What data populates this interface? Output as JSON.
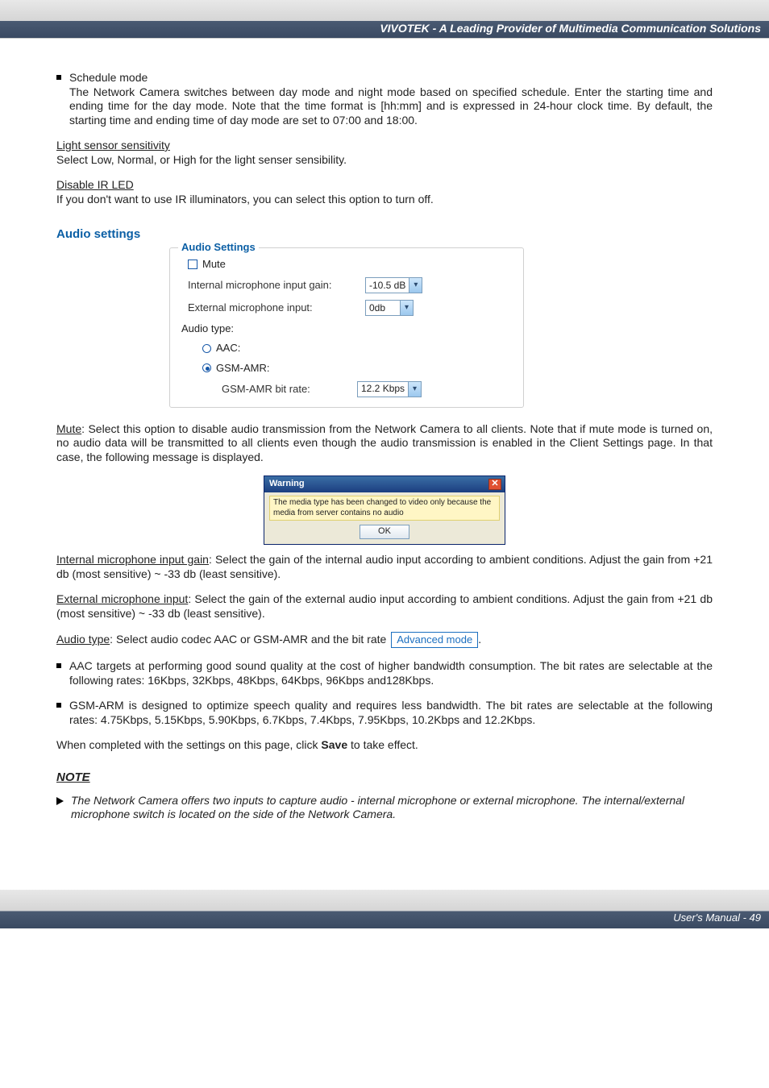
{
  "header": {
    "title": "VIVOTEK - A Leading Provider of Multimedia Communication Solutions"
  },
  "schedule": {
    "label": "Schedule mode",
    "body": "The Network Camera switches between day mode and night mode based on specified schedule. Enter the starting time and ending time for the day mode. Note that the time format is [hh:mm] and is expressed in 24-hour clock time. By default, the starting time and ending time of day mode are set to 07:00 and 18:00."
  },
  "light": {
    "heading": "Light sensor sensitivity",
    "body": "Select Low, Normal, or High for the light senser sensibility."
  },
  "irled": {
    "heading": "Disable IR LED",
    "body": "If you don't want to use IR illuminators, you can select this option to turn off."
  },
  "audio": {
    "title": "Audio settings",
    "panel": {
      "legend": "Audio Settings",
      "mute": "Mute",
      "int_gain_label": "Internal microphone input gain:",
      "int_gain_val": "-10.5 dB",
      "ext_label": "External microphone input:",
      "ext_val": "0db",
      "type_label": "Audio type:",
      "aac": "AAC:",
      "gsm": "GSM-AMR:",
      "gsm_rate_label": "GSM-AMR bit rate:",
      "gsm_rate_val": "12.2 Kbps"
    },
    "mute_head": "Mute",
    "mute_body": ": Select this option to disable audio transmission from the Network Camera to all clients. Note that if mute mode is turned on, no audio data will be transmitted to all clients even though the audio transmission is enabled in the Client Settings page. In that case, the following message is displayed.",
    "dialog": {
      "title": "Warning",
      "msg": "The media type has been changed to video only because the media from server contains no audio",
      "ok": "OK"
    },
    "int_head": "Internal microphone input gain",
    "int_body": ": Select the gain of the internal audio input according to ambient conditions. Adjust the gain from +21 db (most sensitive) ~ -33 db (least sensitive).",
    "ext_head": "External microphone input",
    "ext_body": ": Select the gain of the external audio input according to ambient conditions. Adjust the gain from +21 db (most sensitive) ~ -33 db (least sensitive).",
    "type_head": "Audio type",
    "type_body1": ": Select audio codec AAC or GSM-AMR and the bit rate",
    "type_badge": "Advanced mode",
    "type_body2": ".",
    "aac_bullet": "AAC targets at performing good sound quality at the cost of higher bandwidth consumption. The bit rates are selectable at the following rates: 16Kbps, 32Kbps, 48Kbps, 64Kbps, 96Kbps and128Kbps.",
    "gsm_bullet": "GSM-ARM is designed to optimize speech quality and requires less bandwidth. The bit rates are selectable at the following rates: 4.75Kbps, 5.15Kbps, 5.90Kbps, 6.7Kbps, 7.4Kbps, 7.95Kbps, 10.2Kbps and 12.2Kbps.",
    "save1": "When completed with the settings on this page, click ",
    "save_bold": "Save",
    "save2": " to take effect."
  },
  "note": {
    "label": "NOTE",
    "body": "The Network Camera offers two inputs to capture audio - internal microphone or external microphone. The internal/external microphone switch is located on the side of the Network Camera."
  },
  "footer": {
    "text": "User's Manual - 49"
  }
}
